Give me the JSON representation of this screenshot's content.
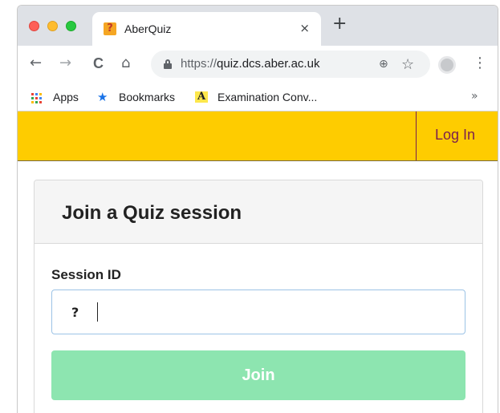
{
  "browser": {
    "tab": {
      "title": "AberQuiz",
      "favicon": "?",
      "close_glyph": "×"
    },
    "new_tab_glyph": "+",
    "toolbar": {
      "back_glyph": "←",
      "forward_glyph": "→",
      "reload_glyph": "C",
      "home_glyph": "⌂",
      "url_protocol": "https://",
      "url_host": "quiz.dcs.aber.ac.uk",
      "zoom_glyph": "⊕",
      "star_glyph": "☆",
      "menu_glyph": "⋮"
    },
    "bookmarks": {
      "apps_label": "Apps",
      "bookmarks_label": "Bookmarks",
      "bookmarks_glyph": "★",
      "exam_glyph": "A",
      "exam_label": "Examination Conv...",
      "more_glyph": "»"
    }
  },
  "site": {
    "header_color": "#fecc00",
    "login_label": "Log In"
  },
  "card": {
    "title": "Join a Quiz session",
    "field_label": "Session ID",
    "input_icon": "?",
    "input_value": "",
    "join_label": "Join",
    "join_color": "#8de5b0"
  }
}
